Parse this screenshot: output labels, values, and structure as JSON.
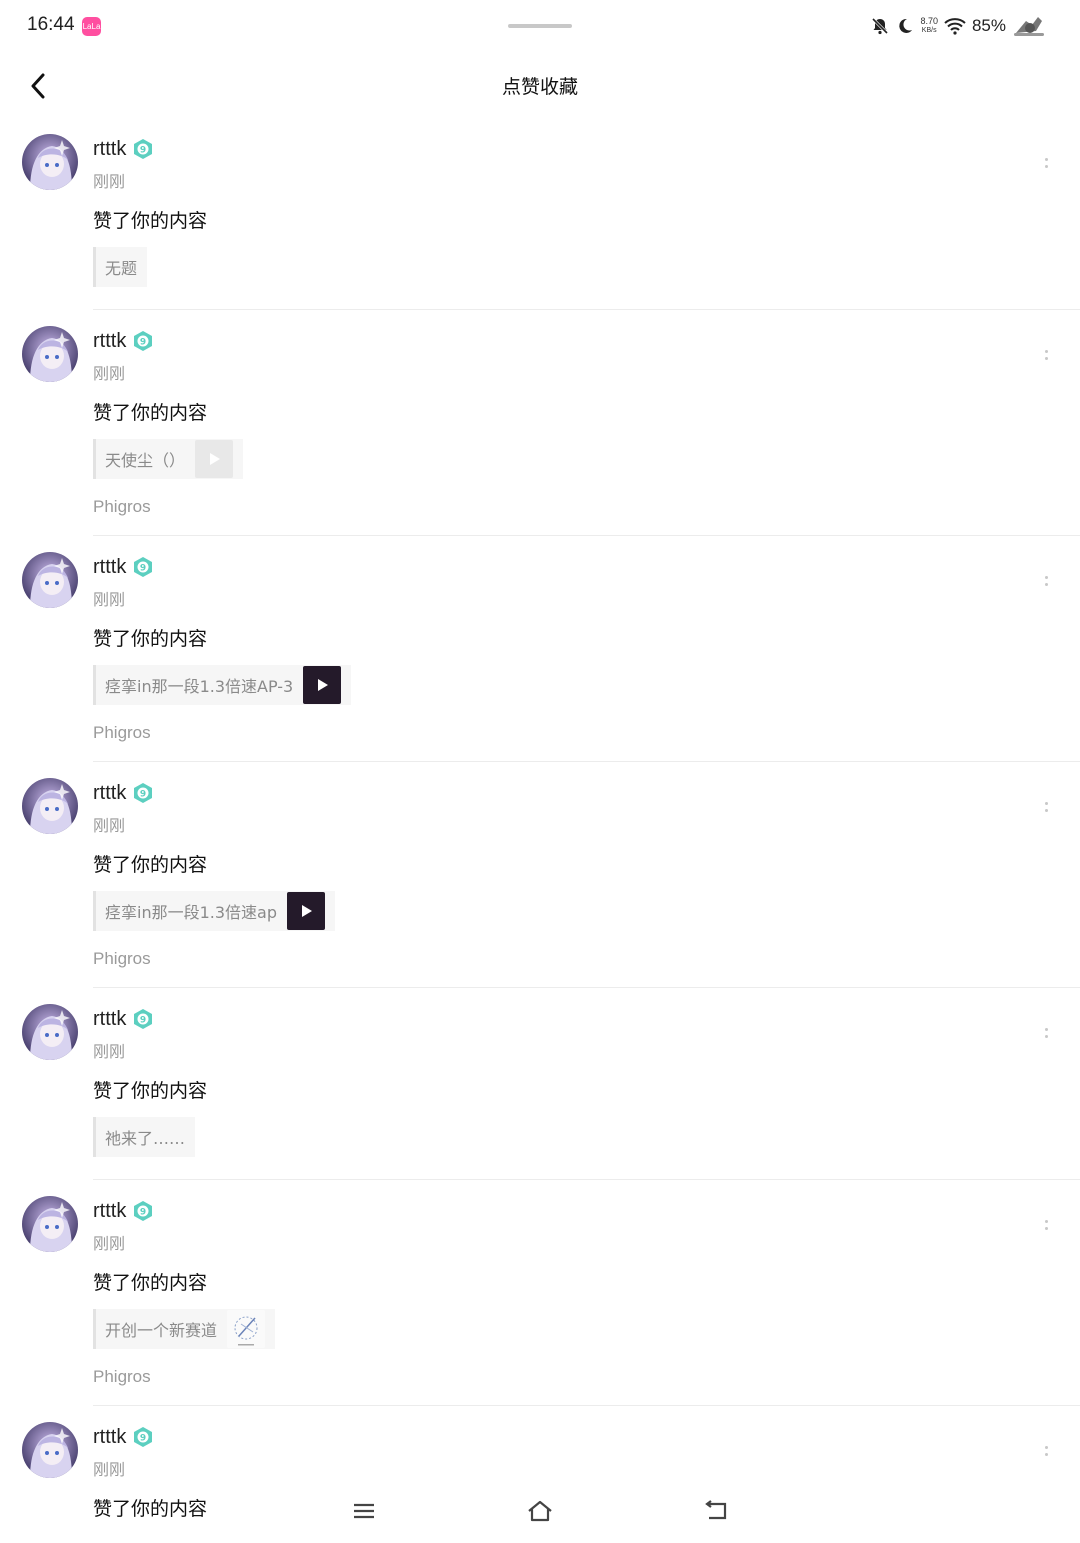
{
  "status_bar": {
    "time": "16:44",
    "app_badge": "LaLa",
    "net_speed_value": "8.70",
    "net_speed_unit": "KB/s",
    "battery": "85%"
  },
  "header": {
    "title": "点赞收藏"
  },
  "accent_color": "#5ccfc0",
  "items": [
    {
      "username": "rtttk",
      "time": "刚刚",
      "action": "赞了你的内容",
      "quote": "无题",
      "thumb": "none",
      "tag": ""
    },
    {
      "username": "rtttk",
      "time": "刚刚",
      "action": "赞了你的内容",
      "quote": "天使尘（）",
      "thumb": "light",
      "tag": "Phigros"
    },
    {
      "username": "rtttk",
      "time": "刚刚",
      "action": "赞了你的内容",
      "quote": "痉挛in那一段1.3倍速AP-3",
      "thumb": "dark",
      "tag": "Phigros"
    },
    {
      "username": "rtttk",
      "time": "刚刚",
      "action": "赞了你的内容",
      "quote": "痉挛in那一段1.3倍速ap",
      "thumb": "dark",
      "tag": "Phigros"
    },
    {
      "username": "rtttk",
      "time": "刚刚",
      "action": "赞了你的内容",
      "quote": "祂来了……",
      "thumb": "none",
      "tag": ""
    },
    {
      "username": "rtttk",
      "time": "刚刚",
      "action": "赞了你的内容",
      "quote": "开创一个新赛道",
      "thumb": "sketch",
      "tag": "Phigros"
    },
    {
      "username": "rtttk",
      "time": "刚刚",
      "action": "赞了你的内容",
      "quote": "",
      "thumb": "none",
      "tag": ""
    }
  ]
}
